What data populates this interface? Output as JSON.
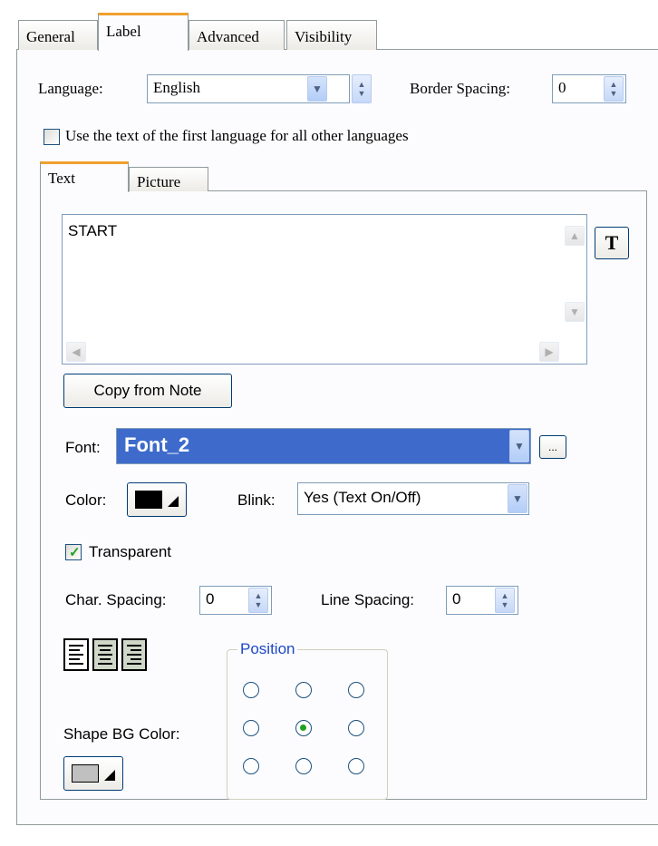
{
  "tabs": [
    "General",
    "Label",
    "Advanced",
    "Visibility"
  ],
  "language": {
    "label": "Language:",
    "value": "English"
  },
  "border_spacing": {
    "label": "Border Spacing:",
    "value": "0"
  },
  "use_first_language": {
    "label": "Use the text of the first language for all other languages",
    "checked": false
  },
  "inner_tabs": [
    "Text",
    "Picture"
  ],
  "text_area": {
    "value": "START"
  },
  "format_button": {
    "label": "T"
  },
  "copy_button": {
    "label": "Copy from Note"
  },
  "font": {
    "label": "Font:",
    "value": "Font_2",
    "more_label": "..."
  },
  "color": {
    "label": "Color:",
    "value": "#000000"
  },
  "blink": {
    "label": "Blink:",
    "value": "Yes (Text On/Off)"
  },
  "transparent": {
    "label": "Transparent",
    "checked": true
  },
  "char_spacing": {
    "label": "Char. Spacing:",
    "value": "0"
  },
  "line_spacing": {
    "label": "Line Spacing:",
    "value": "0"
  },
  "alignment": {
    "options": [
      "left",
      "center",
      "right"
    ]
  },
  "shape_bg_color": {
    "label": "Shape BG Color:",
    "value": "#c0c0c0"
  },
  "position": {
    "label": "Position",
    "selected": "middle-center"
  },
  "colors": {
    "accent_tab": "#f0a030",
    "selection": "#3e6bcb",
    "check": "#21a121",
    "group_title": "#1e48c8"
  }
}
